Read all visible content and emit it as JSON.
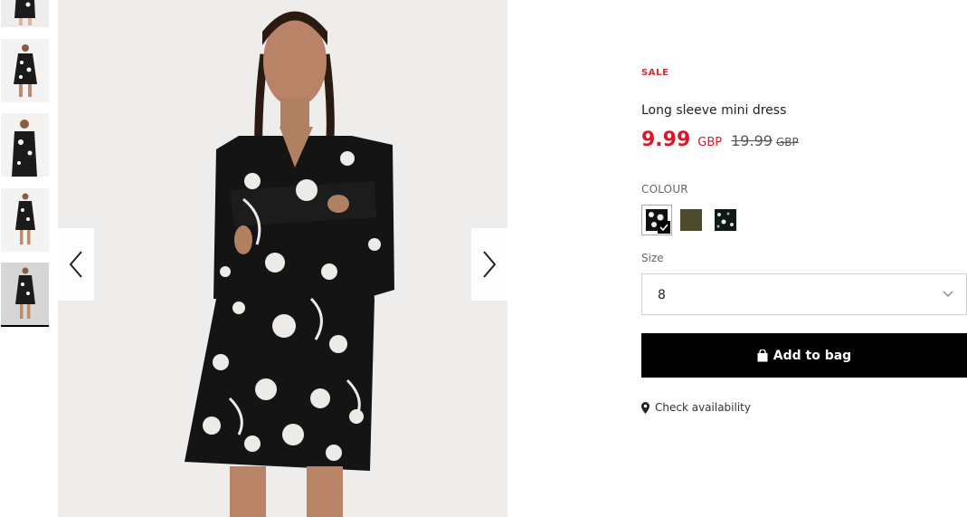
{
  "product": {
    "badge": "SALE",
    "title": "Long sleeve mini dress",
    "price": {
      "current": "9.99",
      "currency": "GBP",
      "original": "19.99",
      "original_currency": "GBP"
    }
  },
  "colour": {
    "label": "COLOUR",
    "swatches": [
      {
        "name": "black-floral",
        "selected": true
      },
      {
        "name": "olive",
        "color": "#4b4a2a",
        "selected": false
      },
      {
        "name": "dark-floral",
        "selected": false
      }
    ]
  },
  "size": {
    "label": "Size",
    "selected": "8"
  },
  "actions": {
    "add_to_bag": "Add to bag",
    "check_availability": "Check availability"
  },
  "gallery": {
    "thumbnail_count": 5,
    "active_index": 4
  },
  "colors": {
    "accent_red": "#d8172a",
    "button_bg": "#000000"
  }
}
